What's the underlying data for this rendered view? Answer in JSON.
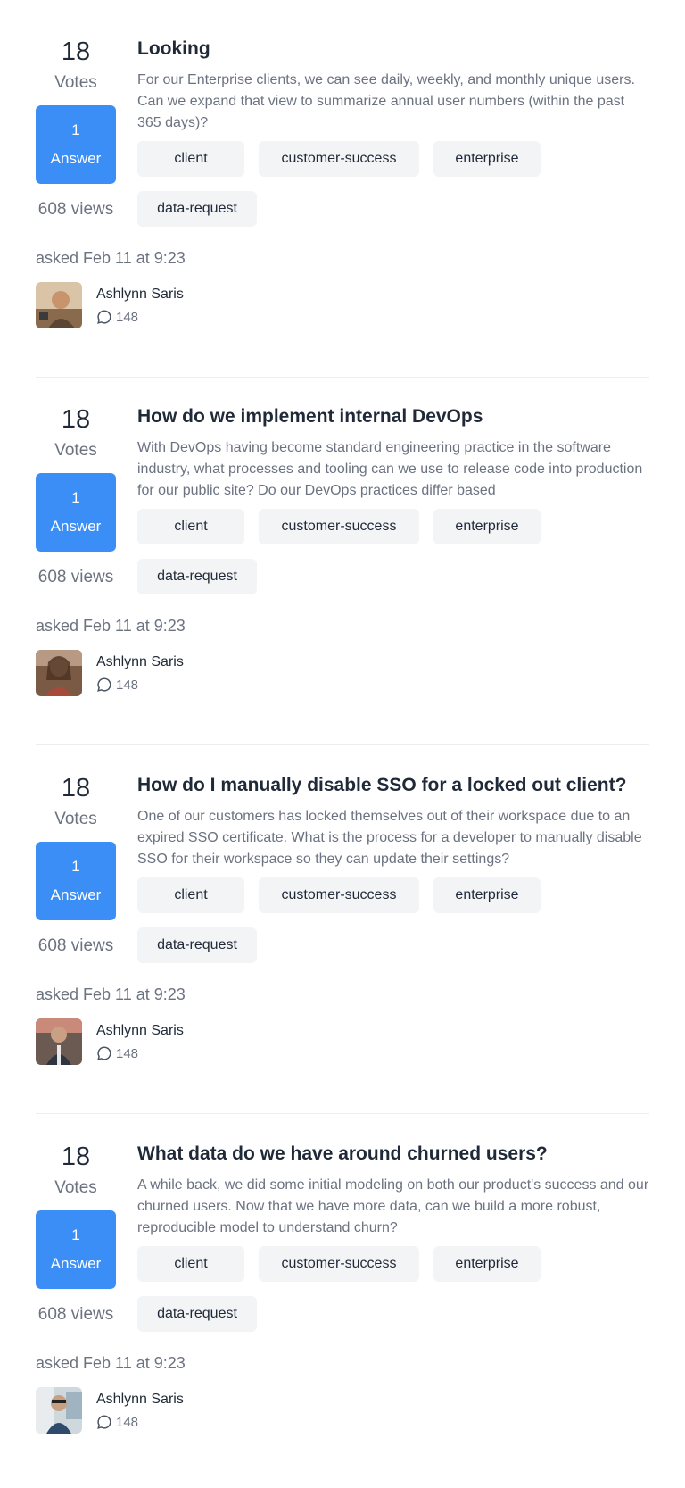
{
  "questions": [
    {
      "votes": "18",
      "votes_label": "Votes",
      "answers_count": "1",
      "answers_label": "Answer",
      "views": "608 views",
      "title": "Looking",
      "excerpt": "For our Enterprise clients, we can see daily, weekly, and monthly unique users. Can we expand that view to summarize annual user numbers (within the past 365 days)?",
      "tags": [
        "client",
        "customer-success",
        "enterprise",
        "data-request"
      ],
      "asked": "asked Feb 11 at 9:23",
      "author": "Ashlynn Saris",
      "comments": "148"
    },
    {
      "votes": "18",
      "votes_label": "Votes",
      "answers_count": "1",
      "answers_label": "Answer",
      "views": "608 views",
      "title": "How do we implement internal DevOps",
      "excerpt": "With DevOps having become standard engineering practice in the software industry, what processes and tooling can we use to release code into production for our public site? Do our DevOps practices differ based",
      "tags": [
        "client",
        "customer-success",
        "enterprise",
        "data-request"
      ],
      "asked": "asked Feb 11 at 9:23",
      "author": "Ashlynn Saris",
      "comments": "148"
    },
    {
      "votes": "18",
      "votes_label": "Votes",
      "answers_count": "1",
      "answers_label": "Answer",
      "views": "608 views",
      "title": "How do I manually disable SSO for a locked out client?",
      "excerpt": "One of our customers has locked themselves out of their workspace due to an expired SSO certificate. What is the process for a developer to manually disable SSO for their workspace so they can update their settings?",
      "tags": [
        "client",
        "customer-success",
        "enterprise",
        "data-request"
      ],
      "asked": "asked Feb 11 at 9:23",
      "author": "Ashlynn Saris",
      "comments": "148"
    },
    {
      "votes": "18",
      "votes_label": "Votes",
      "answers_count": "1",
      "answers_label": "Answer",
      "views": "608 views",
      "title": "What data do we have around churned users?",
      "excerpt": "A while back, we did some initial modeling on both our product's success and our churned users. Now that we have more data, can we build a more robust, reproducible model to understand churn?",
      "tags": [
        "client",
        "customer-success",
        "enterprise",
        "data-request"
      ],
      "asked": "asked Feb 11 at 9:23",
      "author": "Ashlynn Saris",
      "comments": "148"
    }
  ],
  "colors": {
    "accent": "#3b8ef5",
    "tag_bg": "#f3f4f6",
    "muted_text": "#6b7280",
    "divider": "#eceef1"
  },
  "icons": {
    "comment": "comment-bubble-icon",
    "avatar": "avatar"
  }
}
